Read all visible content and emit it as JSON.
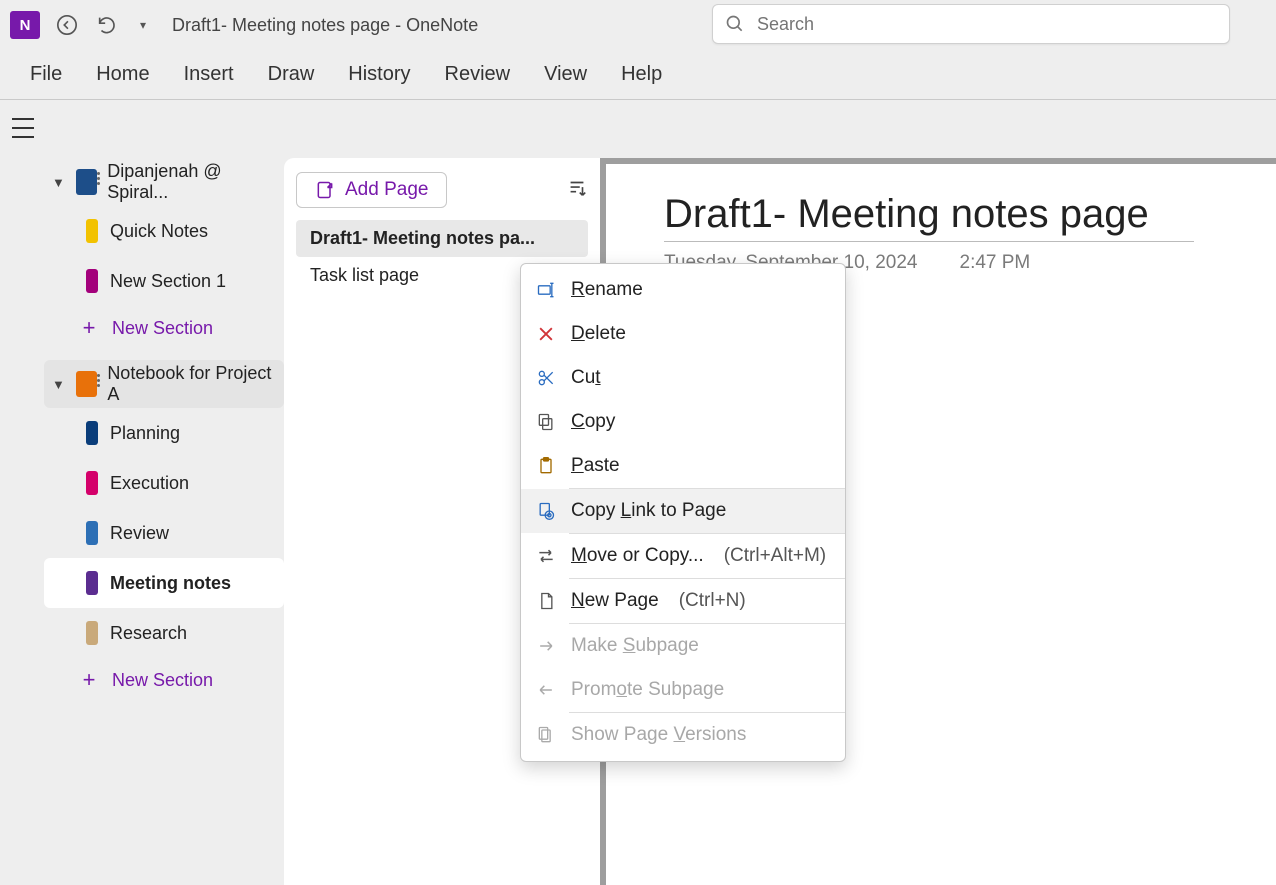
{
  "app": {
    "icon_letter": "N",
    "window_title": "Draft1- Meeting notes page  -  OneNote",
    "search_placeholder": "Search"
  },
  "menubar": {
    "items": [
      "File",
      "Home",
      "Insert",
      "Draw",
      "History",
      "Review",
      "View",
      "Help"
    ]
  },
  "sidebar": {
    "notebooks": [
      {
        "name": "Dipanjenah @ Spiral...",
        "color": "blue",
        "sections": [
          {
            "label": "Quick Notes",
            "color": "#f2c200"
          },
          {
            "label": "New Section 1",
            "color": "#a3007b"
          }
        ]
      },
      {
        "name": "Notebook for Project A",
        "color": "orange",
        "sections": [
          {
            "label": "Planning",
            "color": "#0a3d7a"
          },
          {
            "label": "Execution",
            "color": "#d4006a"
          },
          {
            "label": "Review",
            "color": "#2d6fb5"
          },
          {
            "label": "Meeting notes",
            "color": "#5b2d90",
            "selected": true
          },
          {
            "label": "Research",
            "color": "#c9a97a"
          }
        ]
      }
    ],
    "new_section_label": "New Section"
  },
  "pagelist": {
    "add_page_label": "Add Page",
    "pages": [
      {
        "label": "Draft1- Meeting notes pa...",
        "selected": true
      },
      {
        "label": "Task list page"
      }
    ]
  },
  "canvas": {
    "title": "Draft1- Meeting notes page",
    "date": "Tuesday, September 10, 2024",
    "time": "2:47 PM"
  },
  "context_menu": {
    "items": [
      {
        "icon": "rename",
        "label_pre": "",
        "u": "R",
        "label_post": "ename"
      },
      {
        "icon": "delete",
        "label_pre": "",
        "u": "D",
        "label_post": "elete"
      },
      {
        "icon": "cut",
        "label_pre": "Cu",
        "u": "t",
        "label_post": ""
      },
      {
        "icon": "copy",
        "label_pre": "",
        "u": "C",
        "label_post": "opy"
      },
      {
        "icon": "paste",
        "label_pre": "",
        "u": "P",
        "label_post": "aste"
      },
      {
        "sep": true
      },
      {
        "icon": "link",
        "label_pre": "Copy ",
        "u": "L",
        "label_post": "ink to Page",
        "hover": true
      },
      {
        "sep": true
      },
      {
        "icon": "move",
        "label_pre": "",
        "u": "M",
        "label_post": "ove or Copy...",
        "shortcut": "(Ctrl+Alt+M)"
      },
      {
        "sep": true
      },
      {
        "icon": "newpage",
        "label_pre": "",
        "u": "N",
        "label_post": "ew Page",
        "shortcut": "(Ctrl+N)"
      },
      {
        "sep": true
      },
      {
        "icon": "right",
        "label_pre": "Make ",
        "u": "S",
        "label_post": "ubpage",
        "disabled": true
      },
      {
        "icon": "left",
        "label_pre": "Prom",
        "u": "o",
        "label_post": "te Subpage",
        "disabled": true
      },
      {
        "sep": true
      },
      {
        "icon": "versions",
        "label_pre": "Show Page ",
        "u": "V",
        "label_post": "ersions",
        "disabled": true
      }
    ]
  }
}
